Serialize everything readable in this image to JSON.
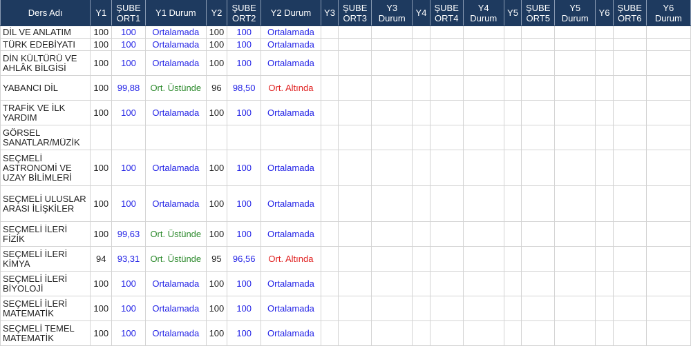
{
  "headers": [
    [
      "Ders Adı"
    ],
    [
      "Y1"
    ],
    [
      "ŞUBE",
      "ORT1"
    ],
    [
      "Y1 Durum"
    ],
    [
      "Y2"
    ],
    [
      "ŞUBE",
      "ORT2"
    ],
    [
      "Y2 Durum"
    ],
    [
      "Y3"
    ],
    [
      "ŞUBE",
      "ORT3"
    ],
    [
      "Y3",
      "Durum"
    ],
    [
      "Y4"
    ],
    [
      "ŞUBE",
      "ORT4"
    ],
    [
      "Y4",
      "Durum"
    ],
    [
      "Y5"
    ],
    [
      "ŞUBE",
      "ORT5"
    ],
    [
      "Y5",
      "Durum"
    ],
    [
      "Y6"
    ],
    [
      "ŞUBE",
      "ORT6"
    ],
    [
      "Y6",
      "Durum"
    ]
  ],
  "status_colors": {
    "Ortalamada": "#2323e6",
    "Ort. Üstünde": "#2e8b2e",
    "Ort. Altında": "#e02020"
  },
  "rows": [
    {
      "name": "DİL VE ANLATIM",
      "y1": "100",
      "ort1": "100",
      "d1": "Ortalamada",
      "y2": "100",
      "ort2": "100",
      "d2": "Ortalamada"
    },
    {
      "name": "TÜRK EDEBİYATI",
      "y1": "100",
      "ort1": "100",
      "d1": "Ortalamada",
      "y2": "100",
      "ort2": "100",
      "d2": "Ortalamada"
    },
    {
      "name": "DİN KÜLTÜRÜ VE AHLÂK BİLGİSİ",
      "y1": "100",
      "ort1": "100",
      "d1": "Ortalamada",
      "y2": "100",
      "ort2": "100",
      "d2": "Ortalamada"
    },
    {
      "name": "YABANCI DİL",
      "y1": "100",
      "ort1": "99,88",
      "d1": "Ort. Üstünde",
      "y2": "96",
      "ort2": "98,50",
      "d2": "Ort. Altında"
    },
    {
      "name": "TRAFİK VE İLK YARDIM",
      "y1": "100",
      "ort1": "100",
      "d1": "Ortalamada",
      "y2": "100",
      "ort2": "100",
      "d2": "Ortalamada"
    },
    {
      "name": "GÖRSEL SANATLAR/MÜZİK",
      "y1": "",
      "ort1": "",
      "d1": "",
      "y2": "",
      "ort2": "",
      "d2": ""
    },
    {
      "name": "SEÇMELİ ASTRONOMİ VE UZAY BİLİMLERİ",
      "y1": "100",
      "ort1": "100",
      "d1": "Ortalamada",
      "y2": "100",
      "ort2": "100",
      "d2": "Ortalamada"
    },
    {
      "name": "SEÇMELİ ULUSLAR ARASI İLİŞKİLER",
      "y1": "100",
      "ort1": "100",
      "d1": "Ortalamada",
      "y2": "100",
      "ort2": "100",
      "d2": "Ortalamada"
    },
    {
      "name": "SEÇMELİ İLERİ FİZİK",
      "y1": "100",
      "ort1": "99,63",
      "d1": "Ort. Üstünde",
      "y2": "100",
      "ort2": "100",
      "d2": "Ortalamada"
    },
    {
      "name": "SEÇMELİ İLERİ KİMYA",
      "y1": "94",
      "ort1": "93,31",
      "d1": "Ort. Üstünde",
      "y2": "95",
      "ort2": "96,56",
      "d2": "Ort. Altında"
    },
    {
      "name": "SEÇMELİ İLERİ BİYOLOJİ",
      "y1": "100",
      "ort1": "100",
      "d1": "Ortalamada",
      "y2": "100",
      "ort2": "100",
      "d2": "Ortalamada"
    },
    {
      "name": "SEÇMELİ İLERİ MATEMATİK",
      "y1": "100",
      "ort1": "100",
      "d1": "Ortalamada",
      "y2": "100",
      "ort2": "100",
      "d2": "Ortalamada"
    },
    {
      "name": "SEÇMELİ TEMEL MATEMATİK",
      "y1": "100",
      "ort1": "100",
      "d1": "Ortalamada",
      "y2": "100",
      "ort2": "100",
      "d2": "Ortalamada"
    }
  ]
}
